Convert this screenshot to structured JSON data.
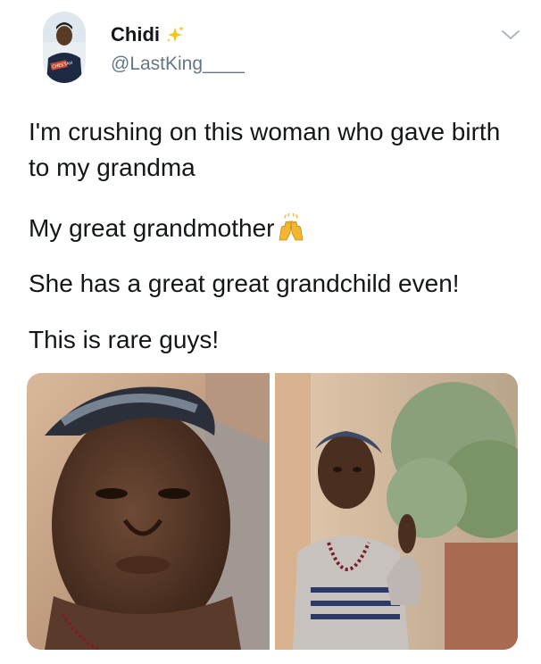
{
  "user": {
    "display_name": "Chidi",
    "handle": "@LastKing____",
    "name_emoji": "sparkles-icon",
    "avatar_caption": "CHEETAH"
  },
  "tweet": {
    "lines": [
      "I'm crushing on this woman who gave birth to my grandma",
      "My great grandmother",
      "She has a great great grandchild even!",
      "This is rare guys!"
    ],
    "emoji_after_line_2": "raising-hands-icon"
  },
  "media": {
    "count": 2,
    "photos": [
      "close-up-selfie-photo",
      "seated-portrait-photo"
    ]
  },
  "colors": {
    "text": "#14171a",
    "secondary_text": "#657786",
    "chevron": "#aab8c2"
  }
}
